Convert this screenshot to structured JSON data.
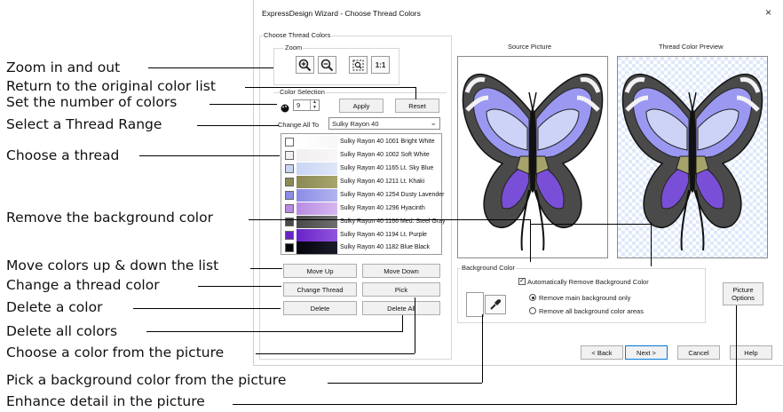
{
  "dialog": {
    "title": "ExpressDesign Wizard - Choose Thread Colors",
    "close_label": "×",
    "group_label": "Choose Thread Colors",
    "zoom": {
      "label": "Zoom",
      "buttons": [
        "zoom-in-icon",
        "zoom-out-icon",
        "zoom-fit-icon"
      ],
      "one_to_one": "1:1"
    },
    "color_selection": {
      "label": "Color Selection",
      "count": "9",
      "apply_label": "Apply",
      "reset_label": "Reset",
      "change_all_label": "Change All To",
      "change_all_value": "Sulky Rayon 40"
    },
    "threads": [
      {
        "name": "Sulky Rayon 40 1001 Bright White",
        "color": "#ffffff",
        "color2": "#f7f7f7",
        "checked": false
      },
      {
        "name": "Sulky Rayon 40 1002 Soft White",
        "color": "#f3eff0",
        "color2": "#f8f6f6",
        "checked": false
      },
      {
        "name": "Sulky Rayon 40 1165 Lt. Sky Blue",
        "color": "#c8d6f4",
        "color2": "#dfe7f8",
        "checked": false
      },
      {
        "name": "Sulky Rayon 40 1211 Lt. Khaki",
        "color": "#8c8a55",
        "color2": "#a7a56c",
        "checked": false
      },
      {
        "name": "Sulky Rayon 40 1254 Dusty Lavender",
        "color": "#8a8ce6",
        "color2": "#b2b3ee",
        "checked": false
      },
      {
        "name": "Sulky Rayon 40 1296 Hyacinth",
        "color": "#b88be3",
        "color2": "#d6b8ee",
        "checked": false
      },
      {
        "name": "Sulky Rayon 40 1166 Med. Steel Gray",
        "color": "#4a4a4a",
        "color2": "#6e6e6e",
        "checked": false
      },
      {
        "name": "Sulky Rayon 40 1194 Lt. Purple",
        "color": "#6a22c9",
        "color2": "#8f55dd",
        "checked": false
      },
      {
        "name": "Sulky Rayon 40 1182 Blue Black",
        "color": "#05050d",
        "color2": "#1a1a2a",
        "checked": false
      }
    ],
    "list_buttons": {
      "move_up": "Move Up",
      "move_down": "Move Down",
      "change_thread": "Change Thread",
      "pick": "Pick",
      "delete": "Delete",
      "delete_all": "Delete All"
    },
    "source_picture_label": "Source Picture",
    "preview_label": "Thread Color Preview",
    "background": {
      "label": "Background Color",
      "auto_remove_label": "Automatically Remove Background Color",
      "auto_remove_checked": true,
      "option_main": "Remove main background only",
      "option_all": "Remove all background color areas",
      "selected_option": "main"
    },
    "picture_options_label": "Picture Options",
    "nav": {
      "back": "< Back",
      "next": "Next >",
      "cancel": "Cancel",
      "help": "Help"
    }
  },
  "callouts": [
    "Zoom in and out",
    "Return to the original color list",
    "Set the number of colors",
    "Select a Thread Range",
    "Choose a thread",
    "Remove the background color",
    "Move colors up & down the list",
    "Change a thread color",
    "Delete a color",
    "Delete all colors",
    "Choose a color from the picture",
    "Pick a background color from the picture",
    "Enhance detail in the picture"
  ],
  "colors": {
    "wing_light": "#ccd3f7",
    "wing_mid": "#9a98f0",
    "wing_purple": "#7a4fd8",
    "wing_dark": "#4a4a4a",
    "wing_khaki": "#a5a36a",
    "wing_white": "#f3f1f5"
  }
}
